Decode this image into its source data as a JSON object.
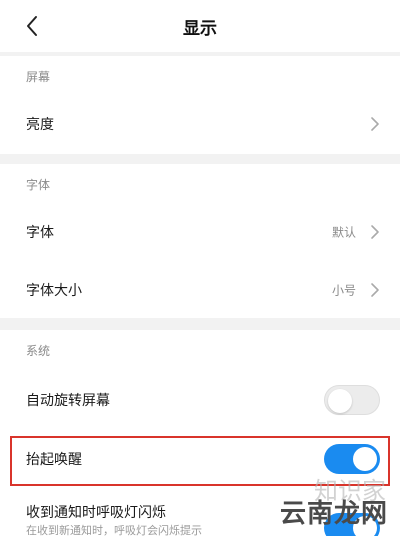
{
  "header": {
    "title": "显示",
    "back_icon": "chevron-left-icon"
  },
  "sections": {
    "screen": {
      "label": "屏幕",
      "brightness_label": "亮度"
    },
    "font": {
      "label": "字体",
      "font_label": "字体",
      "font_value": "默认",
      "font_size_label": "字体大小",
      "font_size_value": "小号"
    },
    "system": {
      "label": "系统",
      "auto_rotate_label": "自动旋转屏幕",
      "auto_rotate_on": false,
      "raise_to_wake_label": "抬起唤醒",
      "raise_to_wake_on": true,
      "breathing_light_label": "收到通知时呼吸灯闪烁",
      "breathing_light_sub": "在收到新通知时，呼吸灯会闪烁提示",
      "breathing_light_on": true
    }
  },
  "watermark": {
    "text": "云南龙网",
    "ghost": "知识家"
  },
  "colors": {
    "accent": "#1a8bf0",
    "highlight": "#d9342b",
    "toggle_off": "#ececec"
  }
}
